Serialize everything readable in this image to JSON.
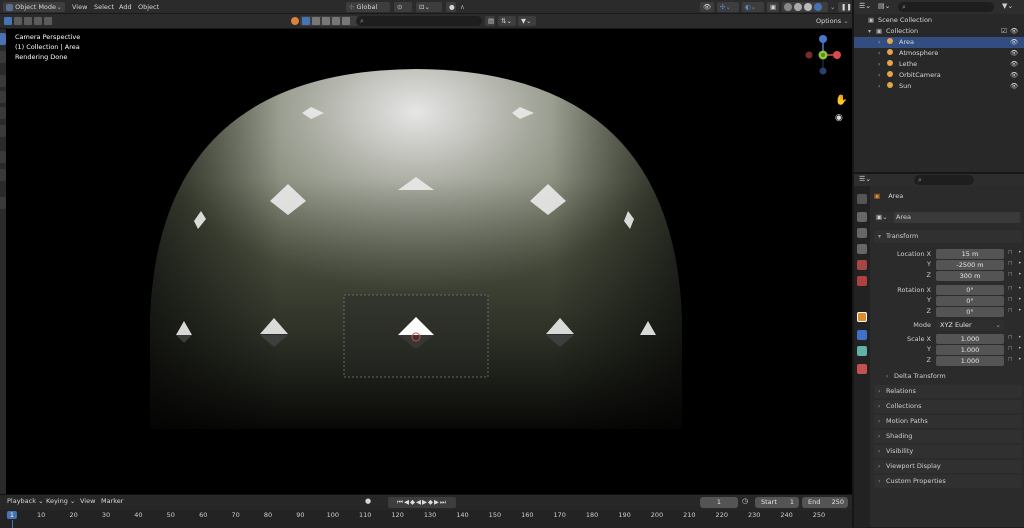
{
  "header": {
    "mode": "Object Mode",
    "menu": [
      "View",
      "Select",
      "Add",
      "Object"
    ],
    "orientation": "Global",
    "options_label": "Options"
  },
  "viewport": {
    "hud": [
      "Camera Perspective",
      "(1) Collection | Area",
      "Rendering Done"
    ]
  },
  "timeline": {
    "menu": [
      "Playback",
      "Keying",
      "View",
      "Marker"
    ],
    "current_frame": "1",
    "start_label": "Start",
    "start_value": "1",
    "end_label": "End",
    "end_value": "250",
    "ticks": [
      "1",
      "10",
      "20",
      "30",
      "40",
      "50",
      "60",
      "70",
      "80",
      "90",
      "100",
      "110",
      "120",
      "130",
      "140",
      "150",
      "160",
      "170",
      "180",
      "190",
      "200",
      "210",
      "220",
      "230",
      "240",
      "250"
    ]
  },
  "outliner": {
    "scene_collection": "Scene Collection",
    "collection": "Collection",
    "items": [
      {
        "name": "Area",
        "icon": "area-light-icon",
        "color": "#e4a44a",
        "selected": true
      },
      {
        "name": "Atmosphere",
        "icon": "mesh-icon",
        "color": "#e4a44a",
        "selected": false
      },
      {
        "name": "Lethe",
        "icon": "mesh-icon",
        "color": "#e4a44a",
        "selected": false
      },
      {
        "name": "OrbitCamera",
        "icon": "camera-icon",
        "color": "#e4a44a",
        "selected": false
      },
      {
        "name": "Sun",
        "icon": "sun-light-icon",
        "color": "#e4a44a",
        "selected": false
      }
    ]
  },
  "properties": {
    "object_name": "Area",
    "data_name": "Area",
    "transform_label": "Transform",
    "location_label": "Location X",
    "rotation_label": "Rotation X",
    "scale_label": "Scale X",
    "mode_label": "Mode",
    "y_label": "Y",
    "z_label": "Z",
    "location": [
      "15 m",
      "-2500 m",
      "300 m"
    ],
    "rotation": [
      "0°",
      "0°",
      "0°"
    ],
    "mode": "XYZ Euler",
    "scale": [
      "1.000",
      "1.000",
      "1.000"
    ],
    "delta_transform": "Delta Transform",
    "panels": [
      "Relations",
      "Collections",
      "Motion Paths",
      "Shading",
      "Visibility",
      "Viewport Display",
      "Custom Properties"
    ]
  },
  "colors": {
    "accent": "#4772b3",
    "selected_row": "#334d80",
    "object_orange": "#e4a44a"
  }
}
